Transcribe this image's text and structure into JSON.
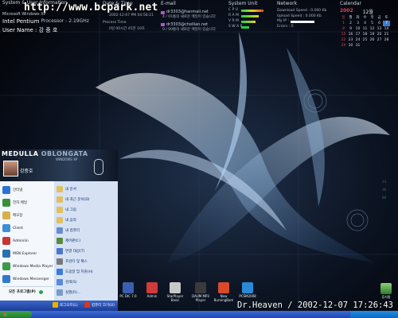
{
  "watermark": "http://www.bcpark.net",
  "sysinfo": {
    "title": "System & User Information",
    "line1": "Microsoft Windows XP",
    "cpu": "Intel Pentium",
    "cpu_suffix": "Processor - 2.19GHz",
    "user": "User Name : 강 중 호"
  },
  "datetime": {
    "title": "Date & Time",
    "value": "2002-12-07 PM 04:58:21",
    "process_title": "Process Time",
    "process_value": "0일 00시간 45분 10초"
  },
  "email": {
    "title": "E-mail",
    "rows": [
      {
        "addr": "dr3303@hanmail.net",
        "msg": "4 / 01통의 새로운 메일이 있습니다"
      },
      {
        "addr": "dr3303@chollian.net",
        "msg": "0 / 00통의 새로운 메일이 있습니다"
      }
    ]
  },
  "sysunit": {
    "title": "System Unit",
    "rows": [
      "C P U",
      "R A M",
      "V R M",
      "S W A P"
    ]
  },
  "network": {
    "title": "Network",
    "download": "Download Speed : 0.000 Kb",
    "upload": "Upload Speed : 0.000 Kb",
    "ip": "My IP :",
    "errors": "Errors : 0"
  },
  "calendar": {
    "title": "Calendar",
    "year": "2002",
    "month": "12월",
    "weekdays": [
      "일",
      "월",
      "화",
      "수",
      "목",
      "금",
      "토"
    ],
    "days": [
      "1",
      "2",
      "3",
      "4",
      "5",
      "6",
      "7",
      "8",
      "9",
      "10",
      "11",
      "12",
      "13",
      "14",
      "15",
      "16",
      "17",
      "18",
      "19",
      "20",
      "21",
      "22",
      "23",
      "24",
      "25",
      "26",
      "27",
      "28",
      "29",
      "30",
      "31"
    ]
  },
  "start_menu": {
    "brand1": "MEDULLA",
    "brand2": "OBLONGATA",
    "brand_sub": "WINDOWS XP",
    "user": "강중호",
    "left_items": [
      "인터넷",
      "전자 메일",
      "메모장",
      "Client",
      "Adminlin",
      "MSN Explorer",
      "Windows Media Player",
      "Windows Messenger"
    ],
    "all_programs": "모든 프로그램(P)",
    "right_items": [
      "내 문서",
      "내 최근 문서(D)",
      "내 그림",
      "내 음악",
      "내 컴퓨터",
      "제어판(C)",
      "연결 대상(T)",
      "프린터 및 팩스",
      "도움말 및 지원(H)",
      "검색(S)",
      "실행(R)..."
    ],
    "logoff": "로그오프(L)",
    "shutdown": "컴퓨터 끄기(U)"
  },
  "desktop_icons": [
    {
      "label": "PC DIC 7.0"
    },
    {
      "label": "Admin"
    },
    {
      "label": "StarPlayer Basic"
    },
    {
      "label": "DAUM MP3 Player"
    },
    {
      "label": "New BurningBam"
    },
    {
      "label": "PCSM2008"
    }
  ],
  "recycle_bin": "휴지통",
  "signature": "Dr.Heaven / 2002-12-07 17:26:43",
  "colors": {
    "accent": "#3a7bd5",
    "watermark": "#ffffff",
    "email_icon": "#b84fd0"
  }
}
